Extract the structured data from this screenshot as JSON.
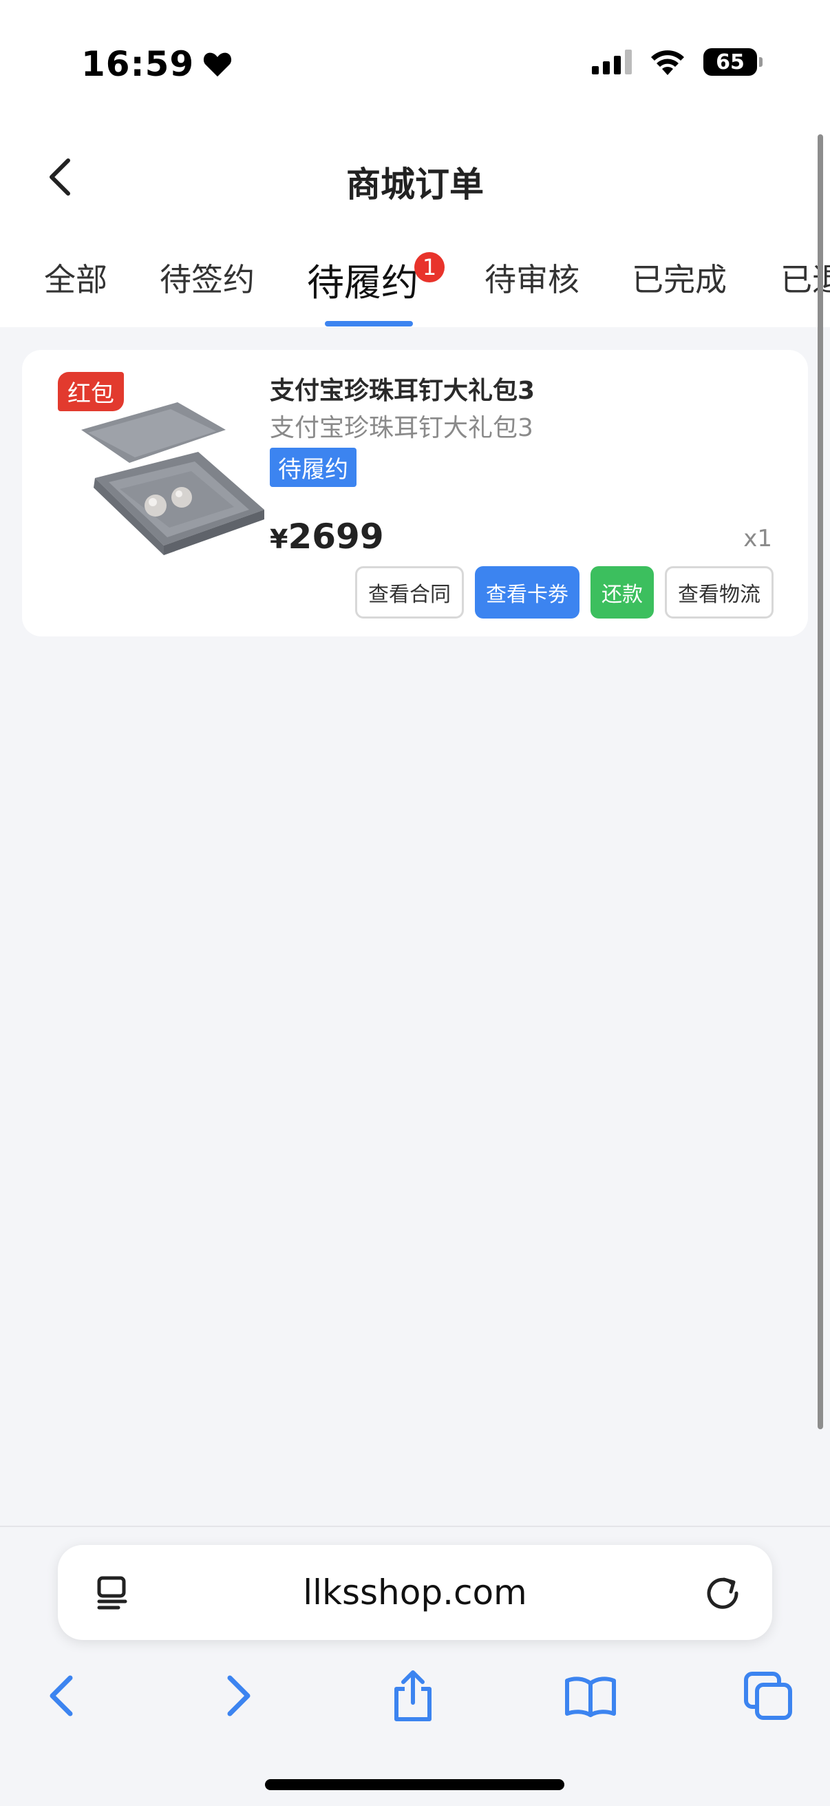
{
  "status_bar": {
    "time": "16:59",
    "battery": "65"
  },
  "header": {
    "title": "商城订单"
  },
  "tabs": [
    {
      "label": "全部"
    },
    {
      "label": "待签约"
    },
    {
      "label": "待履约",
      "active": true,
      "badge": "1"
    },
    {
      "label": "待审核"
    },
    {
      "label": "已完成"
    },
    {
      "label": "已退"
    }
  ],
  "order": {
    "tag": "红包",
    "title": "支付宝珍珠耳钉大礼包3",
    "subtitle": "支付宝珍珠耳钉大礼包3",
    "status": "待履约",
    "currency": "¥",
    "price": "2699",
    "quantity": "x1",
    "buttons": {
      "contract": "查看合同",
      "coupon": "查看卡劵",
      "repay": "还款",
      "logistics": "查看物流"
    }
  },
  "browser": {
    "url": "llksshop.com"
  },
  "colors": {
    "accent": "#3c84f0",
    "repay": "#3cbf5e",
    "badge": "#e8332b",
    "background": "#f4f5f8"
  }
}
